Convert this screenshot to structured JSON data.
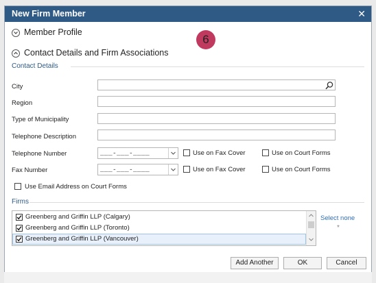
{
  "dialog": {
    "title": "New Firm Member",
    "close_icon": "close-icon"
  },
  "sections": {
    "member_profile": "Member Profile",
    "contact_details_firm": "Contact Details and Firm Associations"
  },
  "badge": "6",
  "contact_details": {
    "group_label": "Contact Details",
    "city_label": "City",
    "city_value": "",
    "region_label": "Region",
    "region_value": "",
    "municipality_label": "Type of Municipality",
    "municipality_value": "",
    "tel_desc_label": "Telephone Description",
    "tel_desc_value": "",
    "tel_number_label": "Telephone Number",
    "tel_number_mask": "___-___-____",
    "tel_fax_cover": "Use on Fax Cover",
    "tel_court_forms": "Use on Court Forms",
    "fax_number_label": "Fax Number",
    "fax_number_mask": "___-___-____",
    "fax_fax_cover": "Use on Fax Cover",
    "fax_court_forms": "Use on Court Forms",
    "email_court_forms": "Use Email Address on Court Forms"
  },
  "firms": {
    "group_label": "Firms",
    "items": [
      {
        "label": "Greenberg and Griffin LLP (Calgary)",
        "checked": true
      },
      {
        "label": "Greenberg and Griffin LLP (Toronto)",
        "checked": true
      },
      {
        "label": "Greenberg and Griffin LLP (Vancouver)",
        "checked": true
      }
    ],
    "select_none": "Select none",
    "required_marker": "*"
  },
  "buttons": {
    "add_another": "Add Another",
    "ok": "OK",
    "cancel": "Cancel"
  },
  "colors": {
    "title_bar": "#2f5a86",
    "accent_link": "#2f6db5",
    "badge": "#c0395e"
  }
}
